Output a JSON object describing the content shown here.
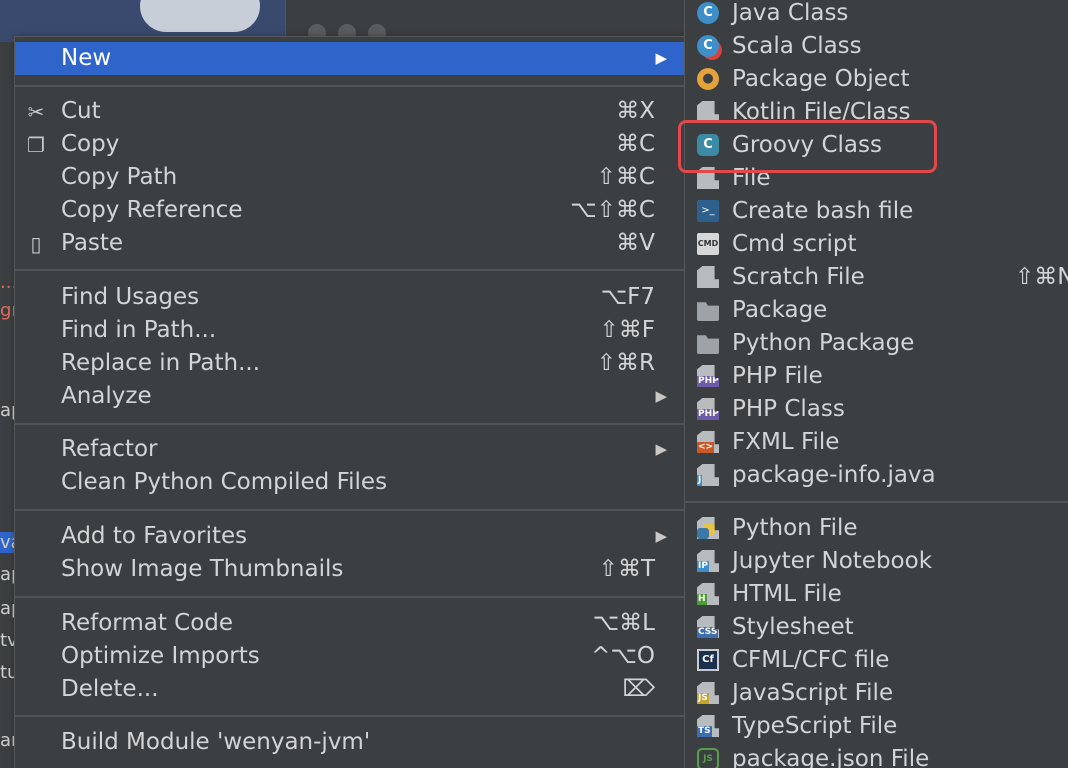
{
  "main_menu": {
    "items": [
      {
        "label": "New",
        "shortcut": "",
        "submenu": true,
        "active": true
      },
      {
        "label": "Cut",
        "shortcut": "⌘X",
        "icon": "scissors-icon"
      },
      {
        "label": "Copy",
        "shortcut": "⌘C",
        "icon": "copy-icon"
      },
      {
        "label": "Copy Path",
        "shortcut": "⇧⌘C"
      },
      {
        "label": "Copy Reference",
        "shortcut": "⌥⇧⌘C"
      },
      {
        "label": "Paste",
        "shortcut": "⌘V",
        "icon": "clipboard-icon"
      },
      {
        "label": "Find Usages",
        "shortcut": "⌥F7"
      },
      {
        "label": "Find in Path...",
        "shortcut": "⇧⌘F"
      },
      {
        "label": "Replace in Path...",
        "shortcut": "⇧⌘R"
      },
      {
        "label": "Analyze",
        "submenu": true
      },
      {
        "label": "Refactor",
        "submenu": true
      },
      {
        "label": "Clean Python Compiled Files"
      },
      {
        "label": "Add to Favorites",
        "submenu": true
      },
      {
        "label": "Show Image Thumbnails",
        "shortcut": "⇧⌘T"
      },
      {
        "label": "Reformat Code",
        "shortcut": "⌥⌘L"
      },
      {
        "label": "Optimize Imports",
        "shortcut": "^⌥O"
      },
      {
        "label": "Delete...",
        "shortcut": "⌦"
      },
      {
        "label": "Build Module 'wenyan-jvm'"
      }
    ],
    "arrow_glyph": "▶"
  },
  "new_submenu": {
    "items": [
      {
        "label": "Java Class",
        "icon": "java-class-icon"
      },
      {
        "label": "Scala Class",
        "icon": "scala-class-icon"
      },
      {
        "label": "Package Object",
        "icon": "package-object-icon"
      },
      {
        "label": "Kotlin File/Class",
        "icon": "kotlin-file-icon"
      },
      {
        "label": "Groovy Class",
        "icon": "groovy-class-icon"
      },
      {
        "label": "File",
        "icon": "file-icon"
      },
      {
        "label": "Create bash file",
        "icon": "bash-icon"
      },
      {
        "label": "Cmd script",
        "icon": "cmd-icon"
      },
      {
        "label": "Scratch File",
        "icon": "scratch-file-icon",
        "shortcut": "⇧⌘N"
      },
      {
        "label": "Package",
        "icon": "package-folder-icon"
      },
      {
        "label": "Python Package",
        "icon": "python-package-icon"
      },
      {
        "label": "PHP File",
        "icon": "php-file-icon"
      },
      {
        "label": "PHP Class",
        "icon": "php-class-icon"
      },
      {
        "label": "FXML File",
        "icon": "fxml-file-icon"
      },
      {
        "label": "package-info.java",
        "icon": "java-file-icon"
      },
      {
        "label": "Python File",
        "icon": "python-file-icon"
      },
      {
        "label": "Jupyter Notebook",
        "icon": "jupyter-icon"
      },
      {
        "label": "HTML File",
        "icon": "html-file-icon"
      },
      {
        "label": "Stylesheet",
        "icon": "css-file-icon"
      },
      {
        "label": "CFML/CFC file",
        "icon": "cfml-icon"
      },
      {
        "label": "JavaScript File",
        "icon": "js-file-icon"
      },
      {
        "label": "TypeScript File",
        "icon": "ts-file-icon"
      },
      {
        "label": "package.json File",
        "icon": "nodejs-icon"
      }
    ],
    "icon_text": {
      "c": "C",
      "cmd": "CMD",
      "php": "PHP",
      "fxml": "<>",
      "java": "J",
      "ip": "IP",
      "html": "H",
      "css": "CSS",
      "cf": "Cf",
      "js": "JS",
      "ts": "TS",
      "node": "JS",
      "bash": ">_"
    }
  },
  "colors": {
    "selection": "#2f65ca",
    "highlight_box": "#e2474b",
    "menu_bg": "#3c3f41",
    "text": "#d2d4d6"
  },
  "background_fragments": [
    "...",
    "gr",
    "ap",
    "va",
    "ap",
    "ap",
    "tv",
    "tu",
    "ar"
  ]
}
